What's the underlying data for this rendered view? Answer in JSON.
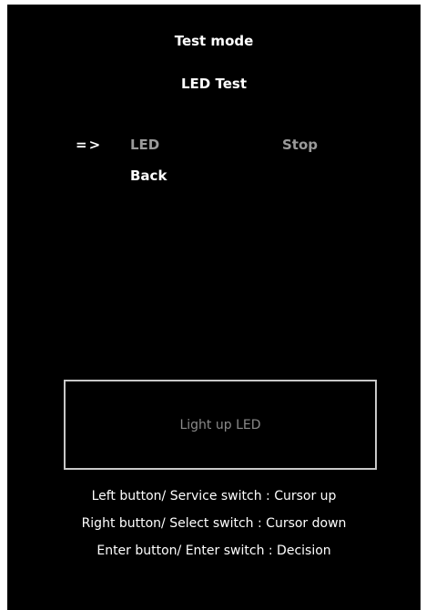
{
  "header": {
    "title": "Test mode",
    "subtitle": "LED Test"
  },
  "menu": {
    "cursor": "=>",
    "items": [
      {
        "label": "LED",
        "value": "Stop"
      },
      {
        "label": "Back"
      }
    ]
  },
  "led_panel": {
    "label": "Light up LED"
  },
  "help": [
    "Left button/ Service switch : Cursor up",
    "Right button/ Select switch : Cursor down",
    "Enter button/ Enter switch : Decision"
  ],
  "colors": {
    "background": "#000000",
    "text": "#ffffff",
    "dim_text": "#9a9a9a",
    "panel_border": "#c8c8c8"
  }
}
